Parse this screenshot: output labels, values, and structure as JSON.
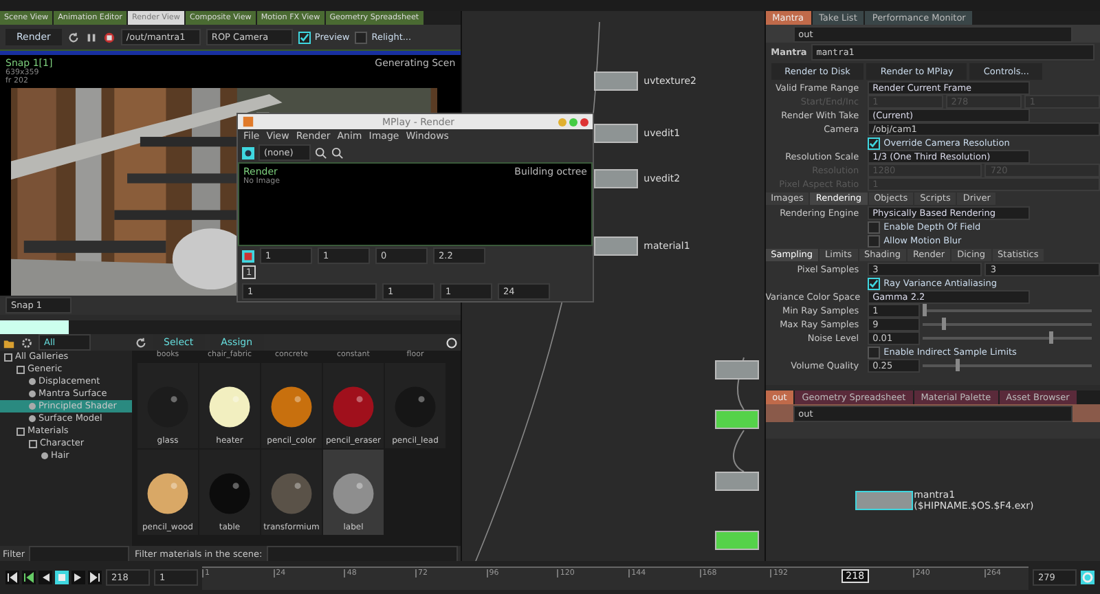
{
  "viewer": {
    "tabs": [
      {
        "label": "Scene View",
        "selected": false
      },
      {
        "label": "Animation Editor",
        "selected": false
      },
      {
        "label": "Render View",
        "selected": true
      },
      {
        "label": "Composite View",
        "selected": false
      },
      {
        "label": "Motion FX View",
        "selected": false
      },
      {
        "label": "Geometry Spreadsheet",
        "selected": false
      }
    ],
    "render_button": "Render",
    "rop_path": "/out/mantra1",
    "camera_mode": "ROP Camera",
    "preview": {
      "label": "Preview",
      "checked": true
    },
    "relight": {
      "label": "Relight...",
      "checked": false
    },
    "snap_title": "Snap 1[1]",
    "snap_size": "639x359",
    "snap_frame": "fr 202",
    "status": "Generating Scen",
    "snap_menu": "Snap 1"
  },
  "mplay": {
    "title": "MPlay - Render",
    "menu": [
      "File",
      "View",
      "Render",
      "Anim",
      "Image",
      "Windows"
    ],
    "channel": "(none)",
    "render_label": "Render",
    "image_label": "No Image",
    "status": "Building octree",
    "controls": [
      "1",
      "1",
      "0",
      "2.2"
    ],
    "frame_box": "1",
    "playback": [
      "1",
      "1",
      "1",
      "24"
    ]
  },
  "gallery": {
    "filter_all": "All",
    "select": "Select",
    "assign": "Assign",
    "tree": [
      {
        "label": "All Galleries",
        "expanded": true,
        "children": [
          {
            "label": "Generic",
            "expanded": true,
            "children": [
              {
                "label": "Displacement",
                "selected": false
              },
              {
                "label": "Mantra Surface",
                "selected": false
              },
              {
                "label": "Principled Shader",
                "selected": true
              },
              {
                "label": "Surface Model",
                "selected": false
              }
            ]
          },
          {
            "label": "Materials",
            "expanded": true,
            "children": [
              {
                "label": "Character",
                "expanded": true,
                "children": [
                  {
                    "label": "Hair",
                    "selected": false
                  }
                ]
              }
            ]
          }
        ]
      }
    ],
    "header_names": [
      "books",
      "chair_fabric",
      "concrete",
      "constant",
      "floor"
    ],
    "materials": [
      {
        "name": "glass",
        "color": "#1c1c1c",
        "selected": false
      },
      {
        "name": "heater",
        "color": "#f2efc0",
        "selected": false
      },
      {
        "name": "pencil_color",
        "color": "#c8700e",
        "selected": false
      },
      {
        "name": "pencil_eraser",
        "color": "#a0101c",
        "selected": false
      },
      {
        "name": "pencil_lead",
        "color": "#161616",
        "selected": false
      },
      {
        "name": "pencil_wood",
        "color": "#d9a866",
        "selected": false
      },
      {
        "name": "table",
        "color": "#0c0c0c",
        "selected": false
      },
      {
        "name": "transformium",
        "color": "#5a5248",
        "selected": false
      },
      {
        "name": "label",
        "color": "#8e8e8e",
        "selected": true
      }
    ],
    "filter_label": "Filter",
    "scene_filter_label": "Filter materials in the scene:"
  },
  "network": {
    "nodes": [
      {
        "name": "uvtexture2",
        "kind": "grey"
      },
      {
        "name": "uvedit1",
        "kind": "grey"
      },
      {
        "name": "uvedit2",
        "kind": "grey"
      },
      {
        "name": "material1",
        "kind": "grey"
      }
    ],
    "side_nodes": [
      {
        "kind": "grey"
      },
      {
        "kind": "green"
      },
      {
        "kind": "grey"
      },
      {
        "kind": "green"
      }
    ]
  },
  "params": {
    "tabs": [
      {
        "label": "Mantra",
        "selected": true
      },
      {
        "label": "Take List",
        "selected": false
      },
      {
        "label": "Performance Monitor",
        "selected": false
      }
    ],
    "path": "out",
    "node_type": "Mantra",
    "node_name": "mantra1",
    "actions": [
      "Render to Disk",
      "Render to MPlay",
      "Controls..."
    ],
    "rows": [
      {
        "kind": "menu",
        "label": "Valid Frame Range",
        "value": "Render Current Frame"
      },
      {
        "kind": "fields",
        "label": "Start/End/Inc",
        "values": [
          "1",
          "278",
          "1"
        ],
        "disabled": true
      },
      {
        "kind": "menu",
        "label": "Render With Take",
        "value": "(Current)"
      },
      {
        "kind": "fields",
        "label": "Camera",
        "values": [
          "/obj/cam1"
        ],
        "disabled": false
      },
      {
        "kind": "check",
        "label": "Override Camera Resolution",
        "checked": true
      },
      {
        "kind": "menu",
        "label": "Resolution Scale",
        "value": "1/3 (One Third Resolution)"
      },
      {
        "kind": "fields",
        "label": "Resolution",
        "values": [
          "1280",
          "720"
        ],
        "disabled": true
      },
      {
        "kind": "fields",
        "label": "Pixel Aspect Ratio",
        "values": [
          "1"
        ],
        "disabled": true
      }
    ],
    "tabs2": [
      {
        "label": "Images",
        "selected": false
      },
      {
        "label": "Rendering",
        "selected": true
      },
      {
        "label": "Objects",
        "selected": false
      },
      {
        "label": "Scripts",
        "selected": false
      },
      {
        "label": "Driver",
        "selected": false
      }
    ],
    "rows2": [
      {
        "kind": "menu",
        "label": "Rendering Engine",
        "value": "Physically Based Rendering"
      },
      {
        "kind": "check",
        "label": "Enable Depth Of Field",
        "checked": false
      },
      {
        "kind": "check",
        "label": "Allow Motion Blur",
        "checked": false
      }
    ],
    "tabs3": [
      {
        "label": "Sampling",
        "selected": true
      },
      {
        "label": "Limits",
        "selected": false
      },
      {
        "label": "Shading",
        "selected": false
      },
      {
        "label": "Render",
        "selected": false
      },
      {
        "label": "Dicing",
        "selected": false
      },
      {
        "label": "Statistics",
        "selected": false
      }
    ],
    "rows3": [
      {
        "kind": "fields",
        "label": "Pixel Samples",
        "values": [
          "3",
          "3"
        ],
        "disabled": false
      },
      {
        "kind": "check",
        "label": "Ray Variance Antialiasing",
        "checked": true
      },
      {
        "kind": "menu",
        "label": "Variance Color Space",
        "value": "Gamma 2.2"
      },
      {
        "kind": "slider",
        "label": "Min Ray Samples",
        "value": "1",
        "level": 0.0
      },
      {
        "kind": "slider",
        "label": "Max Ray Samples",
        "value": "9",
        "level": 0.12
      },
      {
        "kind": "slider",
        "label": "Noise Level",
        "value": "0.01",
        "level": 0.75
      },
      {
        "kind": "check",
        "label": "Enable Indirect Sample Limits",
        "checked": false
      },
      {
        "kind": "slider",
        "label": "Volume Quality",
        "value": "0.25",
        "level": 0.2
      }
    ]
  },
  "out_network": {
    "tabs": [
      {
        "label": "out",
        "selected": true
      },
      {
        "label": "Geometry Spreadsheet",
        "selected": false
      },
      {
        "label": "Material Palette",
        "selected": false
      },
      {
        "label": "Asset Browser",
        "selected": false
      }
    ],
    "path": "out",
    "node_name": "mantra1",
    "node_output": "($HIPNAME.$OS.$F4.exr)"
  },
  "timeline": {
    "frame": "218",
    "step": "1",
    "ticks": [
      "1",
      "24",
      "48",
      "72",
      "96",
      "120",
      "144",
      "168",
      "192"
    ],
    "ticks_after": [
      "240",
      "264"
    ],
    "current": "218",
    "level": 0.774,
    "end": "279"
  }
}
